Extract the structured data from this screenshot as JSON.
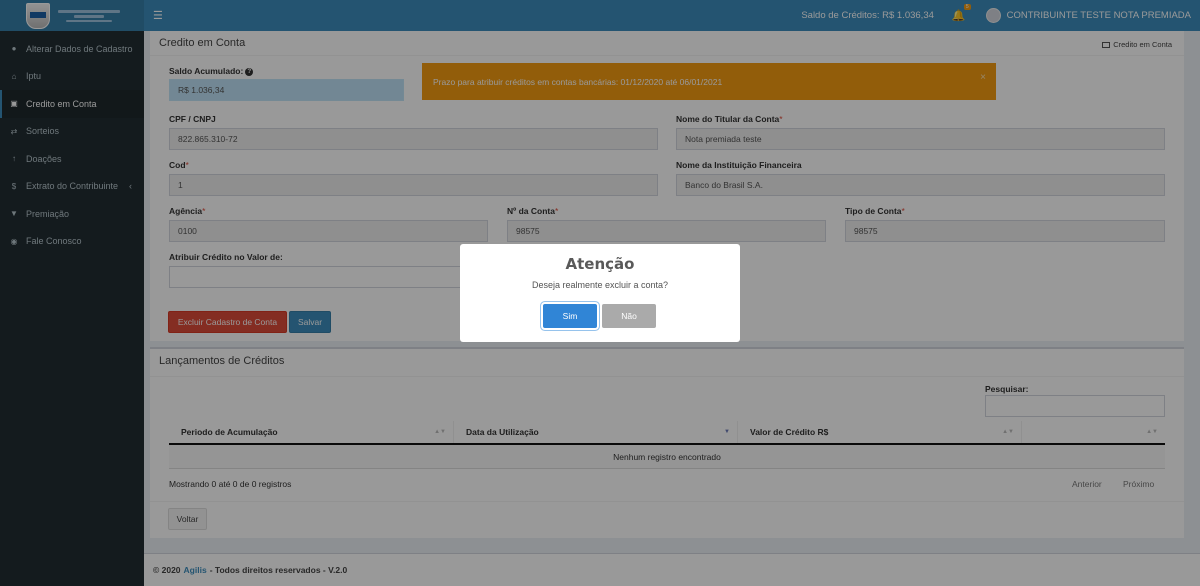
{
  "header": {
    "menu_icon": "hamburger-icon",
    "saldo": "Saldo de Créditos: R$ 1.036,34",
    "notification_count": "5",
    "user": "CONTRIBUINTE TESTE NOTA PREMIADA"
  },
  "sidebar": {
    "items": [
      {
        "label": "Alterar Dados de Cadastro",
        "icon": "user-icon"
      },
      {
        "label": "Iptu",
        "icon": "home-icon"
      },
      {
        "label": "Credito em Conta",
        "icon": "money-icon"
      },
      {
        "label": "Sorteios",
        "icon": "shuffle-icon"
      },
      {
        "label": "Doações",
        "icon": "arrow-up-icon"
      },
      {
        "label": "Extrato do Contribuinte",
        "icon": "dollar-icon"
      },
      {
        "label": "Premiação",
        "icon": "trophy-icon"
      },
      {
        "label": "Fale Conosco",
        "icon": "comments-icon"
      }
    ]
  },
  "credito": {
    "title": "Credito em Conta",
    "tool_label": "Credito em Conta",
    "saldo_label": "Saldo Acumulado:",
    "saldo_value": "R$ 1.036,34",
    "alert": "Prazo para atribuir créditos em contas bancárias: 01/12/2020 até 06/01/2021",
    "cpf_label": "CPF / CNPJ",
    "cpf_value": "822.865.310-72",
    "titular_label": "Nome do Titular da Conta",
    "titular_value": "Nota premiada teste",
    "cod_label": "Cod",
    "cod_value": "1",
    "instituicao_label": "Nome da Instituição Financeira",
    "instituicao_value": "Banco do Brasil S.A.",
    "agencia_label": "Agência",
    "agencia_value": "0100",
    "conta_label": "Nº da Conta",
    "conta_value": "98575",
    "tipo_label": "Tipo de Conta",
    "tipo_value": "98575",
    "valor_label": "Atribuir Crédito no Valor de:",
    "valor_value": "",
    "btn_excluir": "Excluir Cadastro de Conta",
    "btn_salvar": "Salvar",
    "required_mark": "*"
  },
  "lancamentos": {
    "title": "Lançamentos de Créditos",
    "search_label": "Pesquisar:",
    "columns": [
      "Periodo de Acumulação",
      "Data da Utilização",
      "Valor de Crédito R$",
      ""
    ],
    "empty": "Nenhum registro encontrado",
    "info": "Mostrando 0 até 0 de 0 registros",
    "prev": "Anterior",
    "next": "Próximo",
    "btn_voltar": "Voltar"
  },
  "footer": {
    "copy": "© 2020",
    "brand": "Agilis",
    "rest": "- Todos direitos reservados - V.2.0"
  },
  "modal": {
    "title": "Atenção",
    "text": "Deseja realmente excluir a conta?",
    "confirm": "Sim",
    "cancel": "Não"
  }
}
